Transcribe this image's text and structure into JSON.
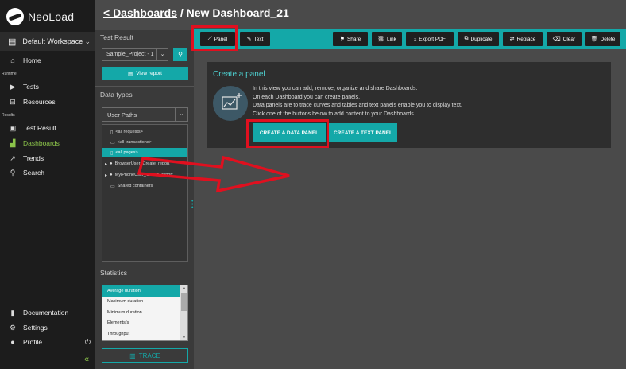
{
  "app": {
    "name": "NeoLoad"
  },
  "nav": {
    "workspace": "Default Workspace",
    "home": "Home",
    "runtime_label": "Runtime",
    "tests": "Tests",
    "resources": "Resources",
    "results_label": "Results",
    "test_result": "Test Result",
    "dashboards": "Dashboards",
    "trends": "Trends",
    "search": "Search",
    "documentation": "Documentation",
    "settings": "Settings",
    "profile": "Profile"
  },
  "breadcrumb": {
    "parent": "< Dashboards",
    "separator": " / ",
    "current": "New Dashboard_21"
  },
  "test_result_panel": {
    "title": "Test Result",
    "selected_project": "Sample_Project - 1",
    "view_report": "View report"
  },
  "data_types": {
    "title": "Data types",
    "selected": "User Paths",
    "tree": [
      {
        "icon": "page-icon",
        "label": "<all requests>",
        "selected": false
      },
      {
        "icon": "folder-icon",
        "label": "<all transactions>",
        "selected": false
      },
      {
        "icon": "page-icon",
        "label": "<all pages>",
        "selected": true
      },
      {
        "icon": "user-icon",
        "label": "BrowserUser_Create_report",
        "selected": false
      },
      {
        "icon": "user-icon",
        "label": "MyiPhoneUser_Create_report",
        "selected": false
      },
      {
        "icon": "folder-icon",
        "label": "Shared containers",
        "selected": false
      }
    ]
  },
  "statistics": {
    "title": "Statistics",
    "items": [
      {
        "label": "Average duration",
        "selected": true
      },
      {
        "label": "Maximum duration",
        "selected": false
      },
      {
        "label": "Minimum duration",
        "selected": false
      },
      {
        "label": "Elements/s",
        "selected": false
      },
      {
        "label": "Throughput",
        "selected": false
      }
    ],
    "trace": "TRACE"
  },
  "toolbar": {
    "panel": "Panel",
    "text": "Text",
    "share": "Share",
    "link": "Link",
    "export_pdf": "Export PDF",
    "duplicate": "Duplicate",
    "replace": "Replace",
    "clear": "Clear",
    "delete": "Delete"
  },
  "create_panel": {
    "title": "Create a panel",
    "lines": [
      "In this view you can add, remove, organize and share Dashboards.",
      "On each Dashboard you can create panels.",
      "Data panels are to trace curves and tables and text panels enable you to display text.",
      "Click one of the buttons below to add content to your Dashboards."
    ],
    "create_data": "CREATE A DATA PANEL",
    "create_text": "CREATE A TEXT PANEL"
  },
  "colors": {
    "accent": "#14a8a8",
    "highlight": "#e0101f",
    "active_nav": "#8bc34a"
  }
}
